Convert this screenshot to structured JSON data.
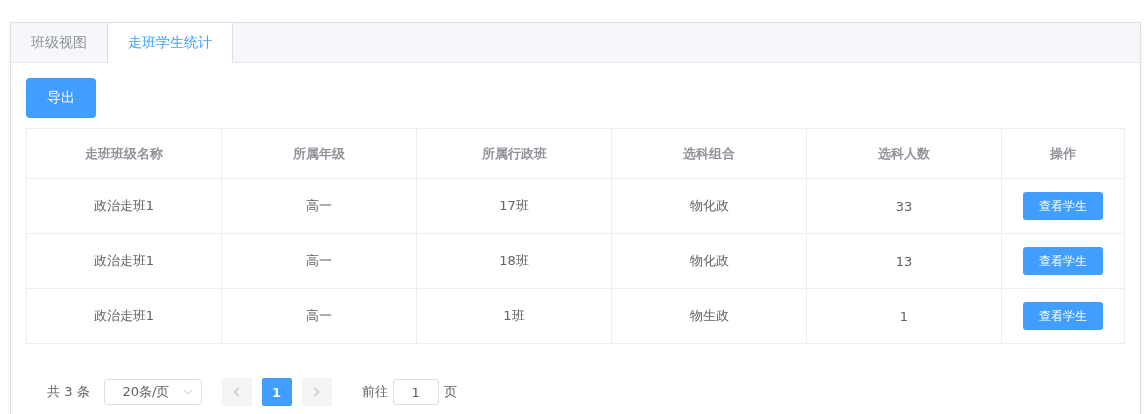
{
  "tabs": [
    {
      "label": "班级视图",
      "selected": false
    },
    {
      "label": "走班学生统计",
      "selected": true
    }
  ],
  "export_button": "导出",
  "table": {
    "columns": [
      "走班班级名称",
      "所属年级",
      "所属行政班",
      "选科组合",
      "选科人数",
      "操作"
    ],
    "rows": [
      {
        "cells": [
          "政治走班1",
          "高一",
          "17班",
          "物化政",
          "33"
        ],
        "action": "查看学生"
      },
      {
        "cells": [
          "政治走班1",
          "高一",
          "18班",
          "物化政",
          "13"
        ],
        "action": "查看学生"
      },
      {
        "cells": [
          "政治走班1",
          "高一",
          "1班",
          "物生政",
          "1"
        ],
        "action": "查看学生"
      }
    ]
  },
  "pagination": {
    "total": "共 3 条",
    "page_size": "20条/页",
    "pages": [
      {
        "label": "1",
        "selected": true
      }
    ],
    "goto_label": "前往",
    "goto_value": "1",
    "goto_suffix": "页"
  }
}
